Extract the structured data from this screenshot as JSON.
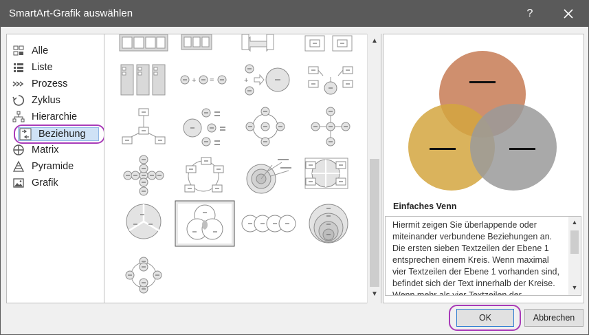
{
  "dialog": {
    "title": "SmartArt-Grafik auswählen",
    "help_label": "?",
    "close_icon": "close-icon"
  },
  "categories": [
    {
      "label": "Alle",
      "icon": "all-grid-icon"
    },
    {
      "label": "Liste",
      "icon": "list-icon"
    },
    {
      "label": "Prozess",
      "icon": "process-icon"
    },
    {
      "label": "Zyklus",
      "icon": "cycle-icon"
    },
    {
      "label": "Hierarchie",
      "icon": "hierarchy-icon"
    },
    {
      "label": "Beziehung",
      "icon": "relationship-icon",
      "selected": true
    },
    {
      "label": "Matrix",
      "icon": "matrix-icon"
    },
    {
      "label": "Pyramide",
      "icon": "pyramid-icon"
    },
    {
      "label": "Grafik",
      "icon": "picture-icon"
    }
  ],
  "gallery": {
    "selected_index": 17,
    "items": [
      "layout-thumbnail",
      "layout-thumbnail",
      "layout-thumbnail",
      "layout-thumbnail",
      "layout-thumbnail",
      "layout-thumbnail",
      "layout-thumbnail",
      "layout-thumbnail",
      "layout-thumbnail",
      "layout-thumbnail",
      "layout-thumbnail",
      "layout-thumbnail",
      "layout-thumbnail",
      "layout-thumbnail",
      "layout-thumbnail",
      "layout-thumbnail",
      "layout-thumbnail",
      "basic-venn-thumbnail",
      "layout-thumbnail",
      "layout-thumbnail",
      "layout-thumbnail"
    ]
  },
  "preview": {
    "colors": {
      "top": "#c8805a",
      "left": "#d4a640",
      "right": "#9a9a9a"
    }
  },
  "details": {
    "name": "Einfaches Venn",
    "description": "Hiermit zeigen Sie überlappende oder miteinander verbundene Beziehungen an. Die ersten sieben Textzeilen der Ebene 1 entsprechen einem Kreis. Wenn maximal vier Textzeilen der Ebene 1 vorhanden sind, befindet sich der Text innerhalb der Kreise. Wenn mehr als vier Textzeilen der"
  },
  "buttons": {
    "ok": "OK",
    "cancel": "Abbrechen"
  },
  "colors": {
    "titlebar": "#5a5a5a",
    "highlight_ring": "#a83ab8",
    "selection_fill": "#cfe2f6"
  }
}
